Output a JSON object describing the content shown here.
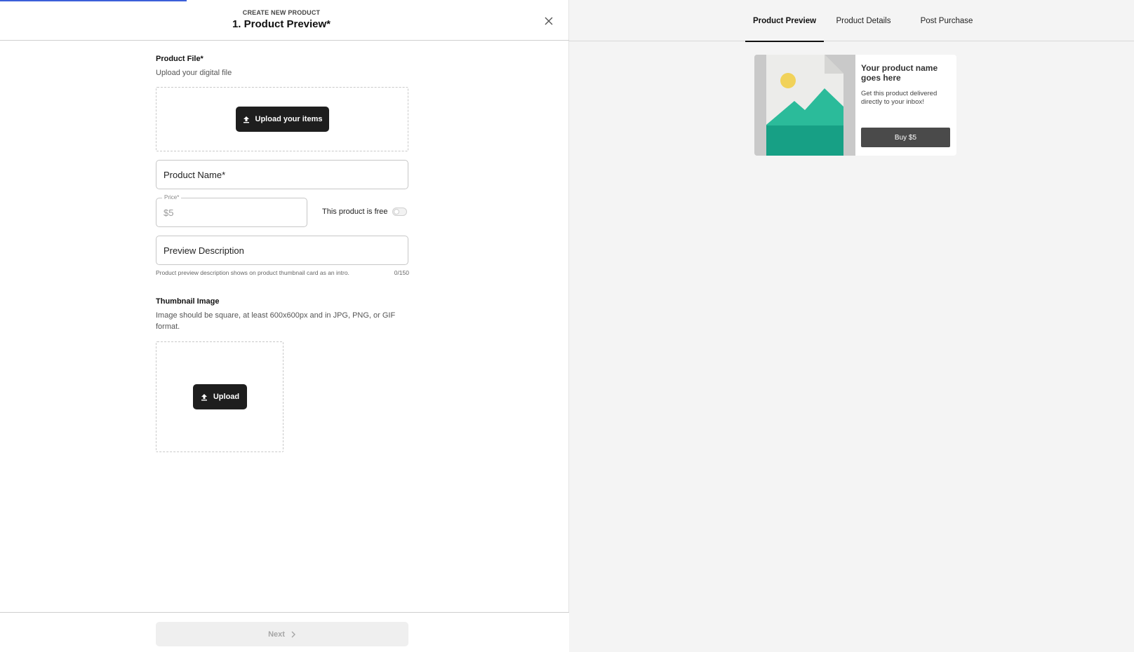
{
  "header": {
    "eyebrow": "CREATE NEW PRODUCT",
    "title": "1. Product Preview*"
  },
  "product_file": {
    "label": "Product File*",
    "help": "Upload your digital file",
    "upload_label": "Upload your items"
  },
  "product_name": {
    "placeholder": "Product Name*"
  },
  "price": {
    "label": "Price*",
    "placeholder": "$5",
    "free_toggle_label": "This product is free",
    "free_toggle_on": false
  },
  "preview_description": {
    "placeholder": "Preview Description",
    "hint": "Product preview description shows on product thumbnail card as an intro.",
    "counter": "0/150"
  },
  "thumbnail": {
    "label": "Thumbnail Image",
    "help": "Image should be square, at least 600x600px and in JPG, PNG, or GIF format.",
    "upload_label": "Upload"
  },
  "footer": {
    "next_label": "Next"
  },
  "preview_tabs": [
    {
      "label": "Product Preview",
      "active": true
    },
    {
      "label": "Product Details",
      "active": false
    },
    {
      "label": "Post Purchase",
      "active": false
    }
  ],
  "preview_card": {
    "title": "Your product name goes here",
    "description": "Get this product delivered directly to your inbox!",
    "buy_label": "Buy $5"
  },
  "colors": {
    "accent_progress": "#3b5fd9",
    "button_dark": "#1e1e1e",
    "preview_teal": "#2bbb9a",
    "preview_teal_dark": "#17a085",
    "preview_sun": "#f1d25a"
  },
  "icons": [
    "close-icon",
    "upload-icon",
    "chevron-right-icon"
  ]
}
